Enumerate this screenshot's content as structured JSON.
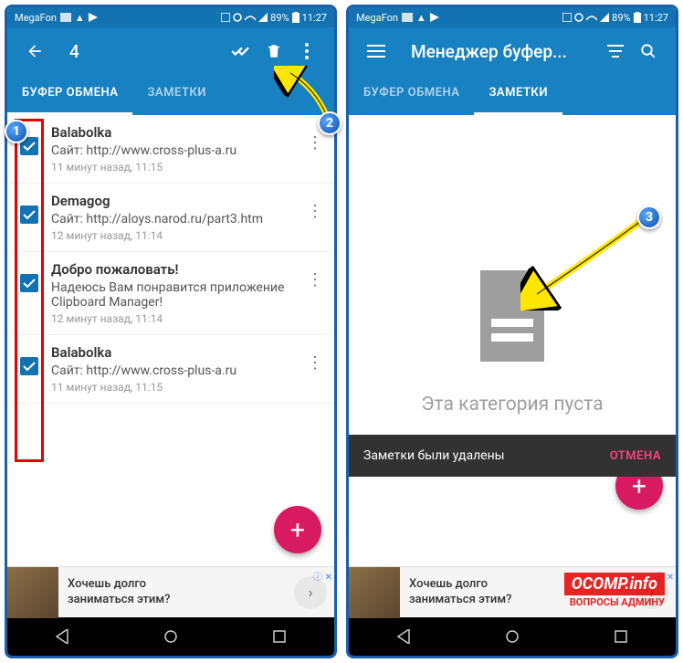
{
  "status": {
    "carrier": "MegaFon",
    "battery": "89%",
    "time": "11:27"
  },
  "left": {
    "selection_count": "4",
    "tabs": {
      "clipboard": "БУФЕР ОБМЕНА",
      "notes": "ЗАМЕТКИ"
    },
    "items": [
      {
        "title": "Balabolka",
        "site": "Сайт: http://www.cross-plus-a.ru",
        "time": "11 минут назад, 11:15"
      },
      {
        "title": "Demagog",
        "site": "Сайт: http://aloys.narod.ru/part3.htm",
        "time": "12 минут назад, 11:14"
      },
      {
        "title": "Добро пожаловать!",
        "site": "Надеюсь Вам понравится приложение Clipboard Manager!",
        "time": "12 минут назад, 11:14"
      },
      {
        "title": "Balabolka",
        "site": "Сайт: http://www.cross-plus-a.ru",
        "time": "11 минут назад, 11:15"
      }
    ]
  },
  "right": {
    "app_title": "Менеджер буфер...",
    "tabs": {
      "clipboard": "БУФЕР ОБМЕНА",
      "notes": "ЗАМЕТКИ"
    },
    "empty_text": "Эта категория пуста",
    "snackbar_text": "Заметки были удалены",
    "snackbar_action": "ОТМЕНА"
  },
  "ad": {
    "line1": "Хочешь долго",
    "line2": "заниматься этим?"
  },
  "callouts": {
    "c1": "1",
    "c2": "2",
    "c3": "3"
  },
  "watermark": {
    "main": "OCOMP.info",
    "sub": "ВОПРОСЫ АДМИНУ"
  }
}
